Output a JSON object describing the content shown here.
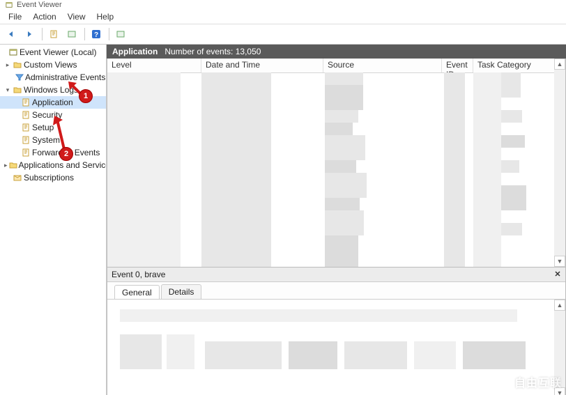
{
  "titlebar": {
    "title": "Event Viewer"
  },
  "menu": {
    "file": "File",
    "action": "Action",
    "view": "View",
    "help": "Help"
  },
  "tree": {
    "root": "Event Viewer (Local)",
    "custom_views": "Custom Views",
    "administrative_events": "Administrative Events",
    "windows_logs": "Windows Logs",
    "application": "Application",
    "security": "Security",
    "setup": "Setup",
    "system": "System",
    "forwarded_events": "Forwarded Events",
    "app_services": "Applications and Services Lo",
    "subscriptions": "Subscriptions"
  },
  "log_header": {
    "name": "Application",
    "count_label": "Number of events: 13,050"
  },
  "columns": {
    "level": "Level",
    "date": "Date and Time",
    "source": "Source",
    "event_id": "Event ID",
    "task": "Task Category"
  },
  "detail": {
    "title": "Event 0, brave",
    "tab_general": "General",
    "tab_details": "Details"
  },
  "annotations": {
    "one": "1",
    "two": "2"
  },
  "watermark": {
    "text": "自由互联"
  }
}
